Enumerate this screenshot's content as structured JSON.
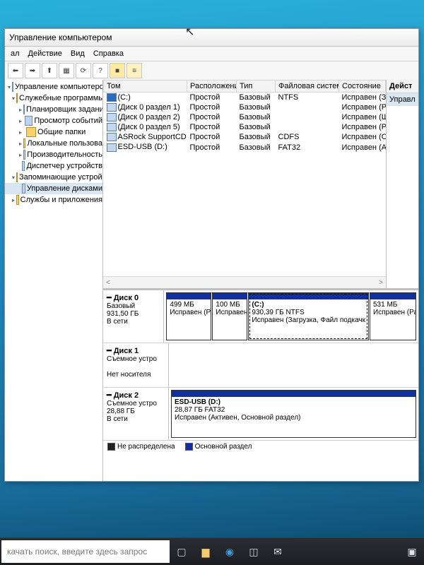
{
  "window": {
    "title": "Управление компьютером"
  },
  "menu": {
    "file": "ал",
    "action": "Действие",
    "view": "Вид",
    "help": "Справка"
  },
  "tree": {
    "root": "Управление компьютером (л",
    "n1": "Служебные программы",
    "n1a": "Планировщик задани",
    "n1b": "Просмотр событий",
    "n1c": "Общие папки",
    "n1d": "Локальные пользова",
    "n1e": "Производительность",
    "n1f": "Диспетчер устройств",
    "n2": "Запоминающие устройст",
    "n2a": "Управление дисками",
    "n3": "Службы и приложения"
  },
  "cols": {
    "vol": "Том",
    "layout": "Расположение",
    "type": "Тип",
    "fs": "Файловая система",
    "status": "Состояние"
  },
  "volumes": [
    {
      "name": "(C:)",
      "layout": "Простой",
      "type": "Базовый",
      "fs": "NTFS",
      "status": "Исправен (Загрузка, Файл подк"
    },
    {
      "name": "(Диск 0 раздел 1)",
      "layout": "Простой",
      "type": "Базовый",
      "fs": "",
      "status": "Исправен (Раздел восстановлен"
    },
    {
      "name": "(Диск 0 раздел 2)",
      "layout": "Простой",
      "type": "Базовый",
      "fs": "",
      "status": "Исправен (Шифрованный (EFI) с"
    },
    {
      "name": "(Диск 0 раздел 5)",
      "layout": "Простой",
      "type": "Базовый",
      "fs": "",
      "status": "Исправен (Раздел восстановлен"
    },
    {
      "name": "ASRock SupportCD (F:)",
      "layout": "Простой",
      "type": "Базовый",
      "fs": "CDFS",
      "status": "Исправен (Основной раздел)"
    },
    {
      "name": "ESD-USB (D:)",
      "layout": "Простой",
      "type": "Базовый",
      "fs": "FAT32",
      "status": "Исправен (Активен, Основной р"
    }
  ],
  "actions": {
    "header": "Дейст",
    "row": "Управл"
  },
  "disk0": {
    "title": "Диск 0",
    "type": "Базовый",
    "size": "931,50 ГБ",
    "state": "В сети",
    "p1": {
      "size": "499 МБ",
      "status": "Исправен (Раз"
    },
    "p2": {
      "size": "100 МБ",
      "status": "Исправен"
    },
    "p3": {
      "name": "(C:)",
      "size": "930,39 ГБ NTFS",
      "status": "Исправен (Загрузка, Файл подкачк"
    },
    "p4": {
      "size": "531 МБ",
      "status": "Исправен (Раз,"
    }
  },
  "disk1": {
    "title": "Диск 1",
    "type": "Съемное устро",
    "state": "Нет носителя"
  },
  "disk2": {
    "title": "Диск 2",
    "type": "Съемное устро",
    "size": "28,88 ГБ",
    "state": "В сети",
    "p1": {
      "name": "ESD-USB (D:)",
      "size": "28,87 ГБ FAT32",
      "status": "Исправен (Активен, Основной раздел)"
    }
  },
  "legend": {
    "unalloc": "Не распределена",
    "primary": "Основной раздел"
  },
  "taskbar": {
    "search": "качать поиск, введите здесь запрос"
  }
}
